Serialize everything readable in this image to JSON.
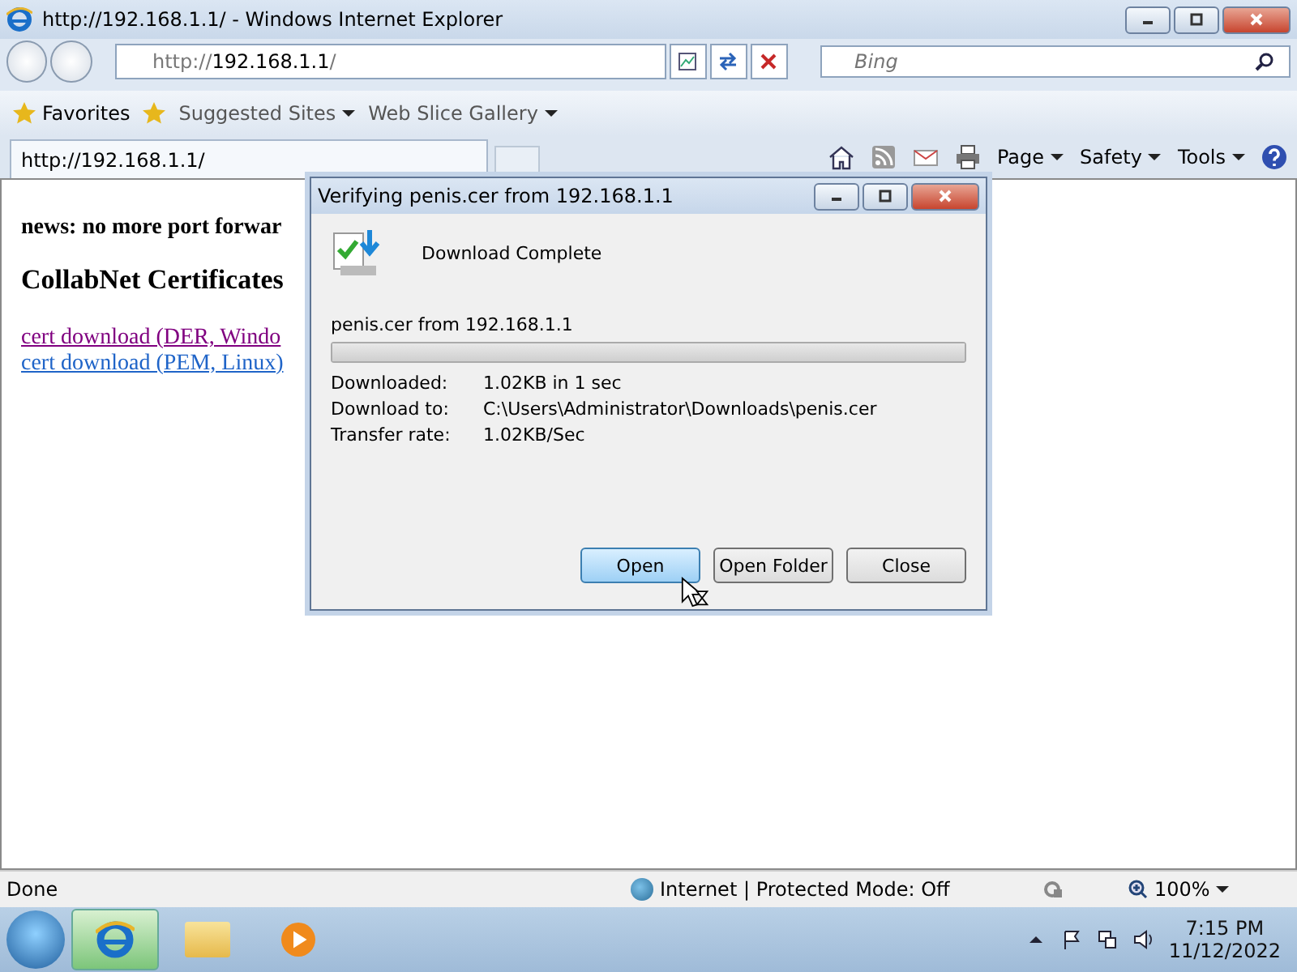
{
  "window": {
    "title": "http://192.168.1.1/ - Windows Internet Explorer"
  },
  "address_bar": {
    "value_prefix": "http://",
    "value_host": "192.168.1.1",
    "value_suffix": "/"
  },
  "search": {
    "placeholder": "Bing"
  },
  "favorites_bar": {
    "favorites": "Favorites",
    "links": [
      {
        "label": "Suggested Sites"
      },
      {
        "label": "Web Slice Gallery"
      }
    ]
  },
  "tab": {
    "label": "http://192.168.1.1/",
    "selected": true
  },
  "command_bar": {
    "items": [
      {
        "kind": "home"
      },
      {
        "kind": "feed"
      },
      {
        "kind": "mail"
      },
      {
        "kind": "print"
      },
      {
        "kind": "menu",
        "label": "Page"
      },
      {
        "kind": "menu",
        "label": "Safety"
      },
      {
        "kind": "menu",
        "label": "Tools"
      },
      {
        "kind": "help"
      }
    ]
  },
  "page": {
    "news": "news: no more port forwar",
    "heading": "CollabNet Certificates",
    "links": [
      {
        "label": "cert download (DER, Windo",
        "visited": true
      },
      {
        "label": "cert download (PEM, Linux)",
        "visited": false
      }
    ]
  },
  "dialog": {
    "title": "Verifying penis.cer from 192.168.1.1",
    "status": "Download Complete",
    "source": "penis.cer from 192.168.1.1",
    "level": 1,
    "details": [
      {
        "label": "Downloaded:",
        "value": "1.02KB in 1 sec"
      },
      {
        "label": "Download to:",
        "value": "C:\\Users\\Administrator\\Downloads\\penis.cer"
      },
      {
        "label": "Transfer rate:",
        "value": "1.02KB/Sec"
      }
    ],
    "buttons": [
      {
        "label": "Open",
        "selected": true
      },
      {
        "label": "Open Folder",
        "selected": false
      },
      {
        "label": "Close",
        "selected": false
      }
    ]
  },
  "status_bar": {
    "status": "Done",
    "zone": "Internet | Protected Mode: Off",
    "zoom": "100%"
  },
  "taskbar": {
    "time": "7:15 PM",
    "date": "11/12/2022"
  }
}
